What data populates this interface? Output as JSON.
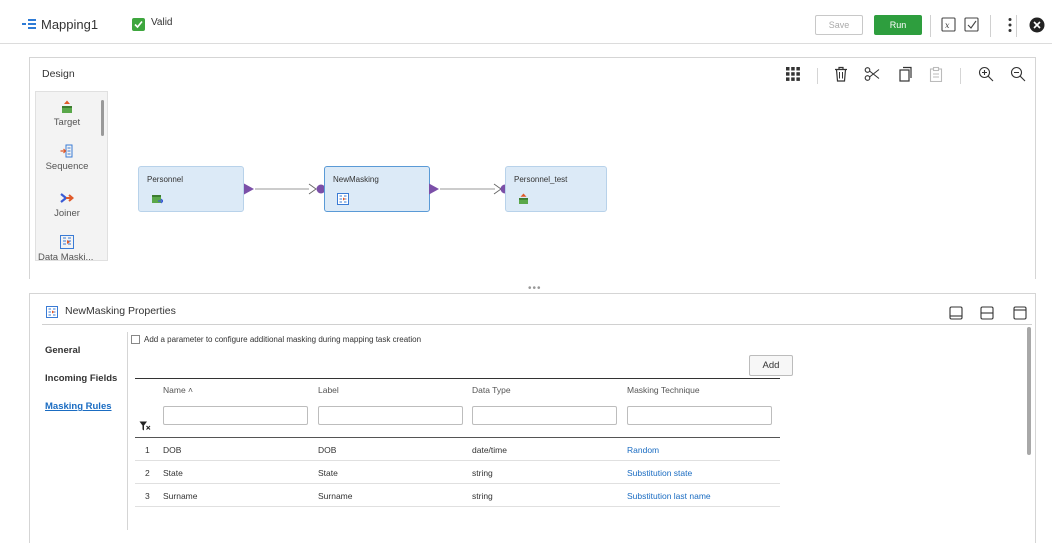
{
  "header": {
    "title": "Mapping1",
    "status": "Valid",
    "save_label": "Save",
    "run_label": "Run",
    "icons": [
      "mapping-icon",
      "valid-check-icon",
      "function-icon",
      "validate-icon",
      "more-vertical-icon",
      "close-circle-icon"
    ]
  },
  "design": {
    "title": "Design",
    "toolbar_icons": [
      "grid-view-icon",
      "delete-icon",
      "cut-icon",
      "copy-icon",
      "paste-icon",
      "zoom-in-icon",
      "zoom-out-icon"
    ],
    "palette": [
      {
        "label": "Target",
        "icon": "target-icon"
      },
      {
        "label": "Sequence",
        "icon": "sequence-icon"
      },
      {
        "label": "Joiner",
        "icon": "joiner-icon"
      },
      {
        "label": "Data Maski...",
        "icon": "data-masking-icon"
      }
    ],
    "nodes": [
      {
        "label": "Personnel",
        "icon": "source-icon"
      },
      {
        "label": "NewMasking",
        "icon": "data-masking-icon"
      },
      {
        "label": "Personnel_test",
        "icon": "target-icon"
      }
    ],
    "resize_grip": "•••"
  },
  "properties": {
    "title": "NewMasking Properties",
    "nav": [
      "General",
      "Incoming Fields",
      "Masking Rules"
    ],
    "active_nav": "Masking Rules",
    "param_label": "Add a parameter to configure additional masking during mapping task creation",
    "add_label": "Add",
    "columns": [
      "Name ˄",
      "Label",
      "Data Type",
      "Masking Technique"
    ],
    "rows": [
      {
        "num": "1",
        "name": "DOB",
        "label": "DOB",
        "type": "date/time",
        "technique": "Random"
      },
      {
        "num": "2",
        "name": "State",
        "label": "State",
        "type": "string",
        "technique": "Substitution state"
      },
      {
        "num": "3",
        "name": "Surname",
        "label": "Surname",
        "type": "string",
        "technique": "Substitution last name"
      }
    ]
  },
  "colors": {
    "accent": "#1a6cc2",
    "run": "#2e9e3e",
    "node_fill": "#dceaf7",
    "port": "#7b4fa8"
  }
}
